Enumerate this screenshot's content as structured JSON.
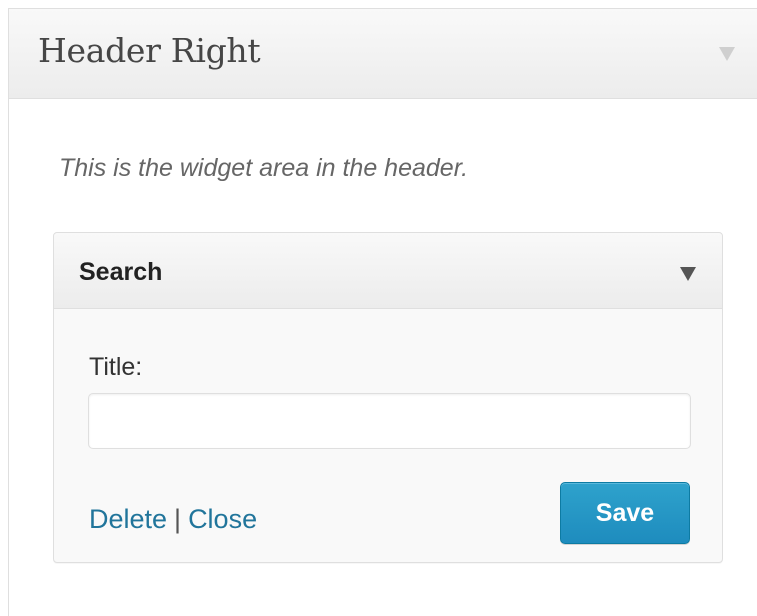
{
  "sidebar": {
    "title": "Header Right",
    "description": "This is the widget area in the header.",
    "toggle_icon": "triangle-down-icon"
  },
  "widget": {
    "title": "Search",
    "toggle_icon": "triangle-down-icon",
    "fields": {
      "title_label": "Title:",
      "title_value": "",
      "title_placeholder": ""
    },
    "actions": {
      "delete_label": "Delete",
      "separator": "|",
      "close_label": "Close",
      "save_label": "Save"
    }
  },
  "colors": {
    "link": "#21759b",
    "save_button": "#2ea2cc",
    "header_text": "#464646"
  }
}
